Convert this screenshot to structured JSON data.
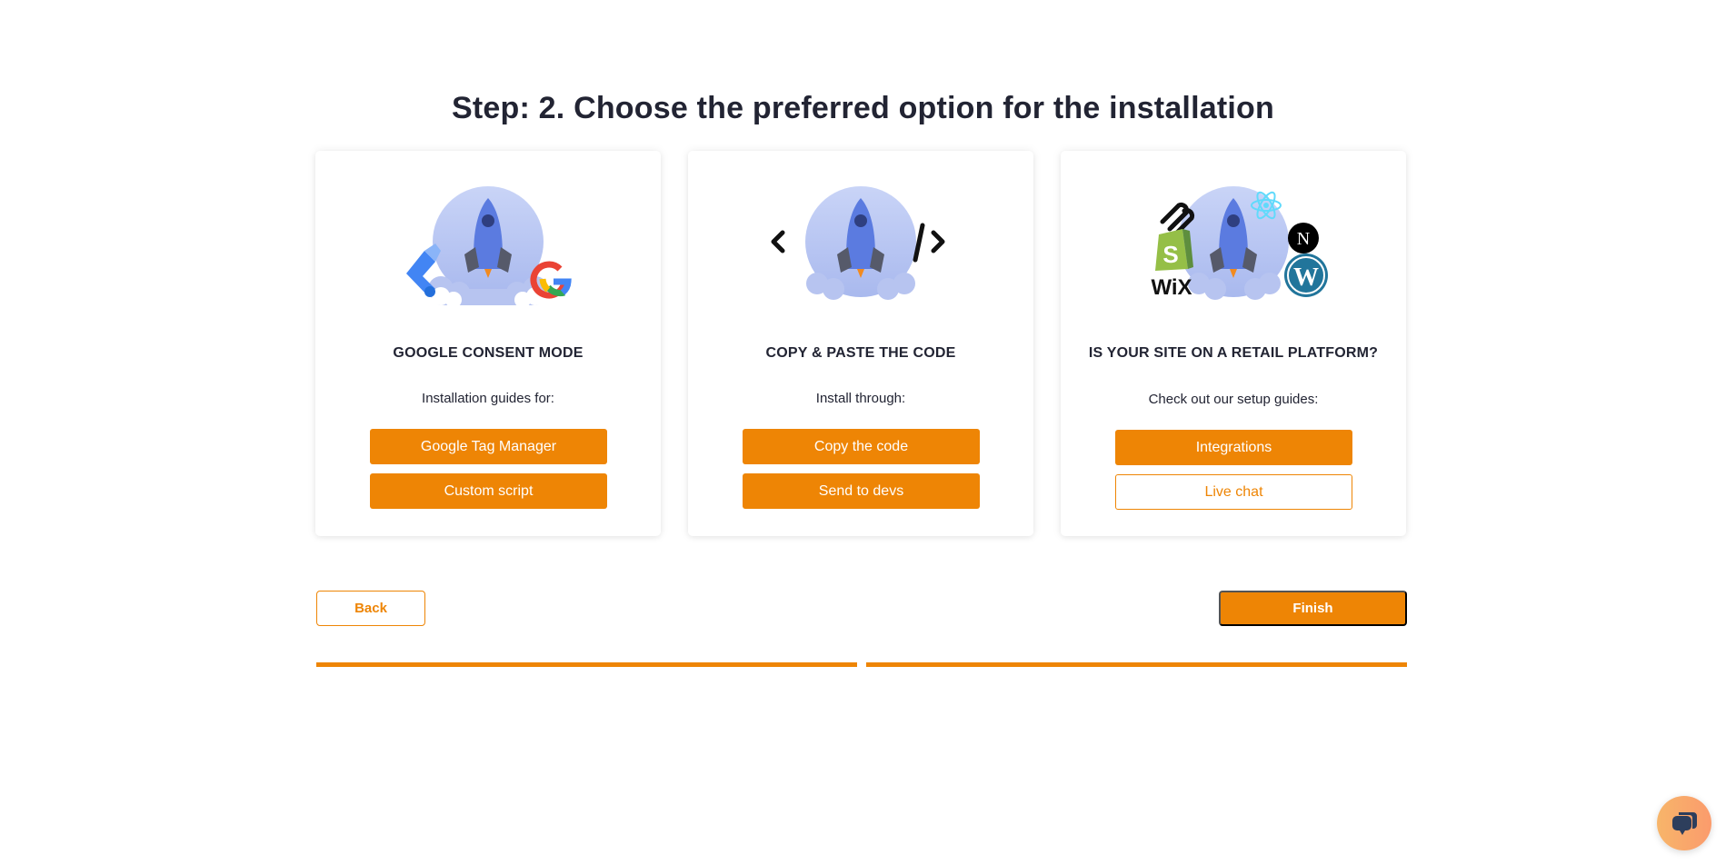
{
  "page": {
    "title": "Step: 2. Choose the preferred option for the installation"
  },
  "cards": [
    {
      "illustration": "rocket-with-gtm-and-google-logos",
      "title": "GOOGLE CONSENT MODE",
      "subtitle": "Installation guides for:",
      "buttons": [
        {
          "label": "Google Tag Manager",
          "style": "filled"
        },
        {
          "label": "Custom script",
          "style": "filled"
        }
      ]
    },
    {
      "illustration": "rocket-with-code-brackets",
      "title": "COPY & PASTE THE CODE",
      "subtitle": "Install through:",
      "buttons": [
        {
          "label": "Copy the code",
          "style": "filled"
        },
        {
          "label": "Send to devs",
          "style": "filled"
        }
      ]
    },
    {
      "illustration": "rocket-with-platform-logos",
      "platform_logos": [
        "squarespace",
        "react",
        "shopify",
        "nextjs",
        "wix",
        "wordpress"
      ],
      "wix_text": "WiX",
      "nextjs_text": "N",
      "wordpress_text": "W",
      "shopify_text": "S",
      "title": "IS YOUR SITE ON A RETAIL PLATFORM?",
      "subtitle": "Check out our setup guides:",
      "buttons": [
        {
          "label": "Integrations",
          "style": "filled"
        },
        {
          "label": "Live chat",
          "style": "outline"
        }
      ]
    }
  ],
  "navigation": {
    "back_label": "Back",
    "finish_label": "Finish"
  },
  "progress": {
    "total_steps": 2,
    "current_step": 2,
    "segments": [
      1.0,
      1.0
    ]
  },
  "chat_widget": {
    "icon": "chat-bubbles-icon"
  },
  "colors": {
    "accent": "#ee8505",
    "heading": "#222433",
    "rocket_body": "#5b7be0",
    "rocket_circle": "#c3cff5",
    "chat_icon": "#2d3e5c"
  }
}
